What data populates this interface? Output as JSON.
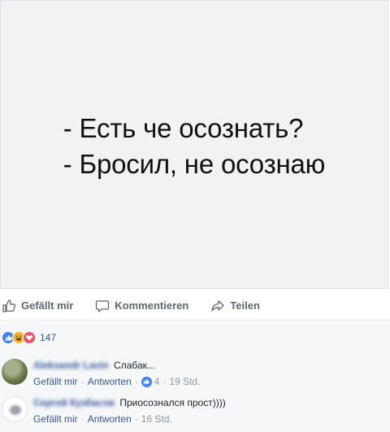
{
  "post": {
    "image_lines": [
      "- Есть че осознать?",
      "- Бросил, не осознаю"
    ]
  },
  "actions": {
    "like_label": "Gefällt mir",
    "comment_label": "Kommentieren",
    "share_label": "Teilen"
  },
  "reactions": {
    "types": [
      "like-icon",
      "haha-icon",
      "love-icon"
    ],
    "count": "147"
  },
  "comments": [
    {
      "author": "Aleksandr Lavin",
      "text": "Слабак...",
      "like_label": "Gefällt mir",
      "reply_label": "Antworten",
      "likes": "4",
      "time": "19 Std."
    },
    {
      "author": "Сергей Кузбасов",
      "text": "Приосознался прост))))",
      "like_label": "Gefällt mir",
      "reply_label": "Antworten",
      "time": "16 Std."
    }
  ],
  "colors": {
    "link": "#385898",
    "muted": "#90949c",
    "like_blue": "#4080ff",
    "haha_yellow": "#f7b125",
    "love_red": "#f25268"
  }
}
